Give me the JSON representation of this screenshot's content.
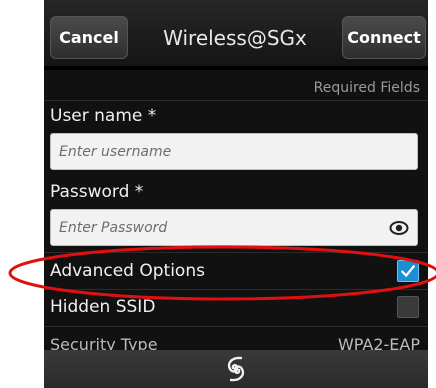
{
  "titlebar": {
    "cancel_label": "Cancel",
    "title": "Wireless@SGx",
    "connect_label": "Connect"
  },
  "form": {
    "required_note": "Required Fields",
    "username_label": "User name *",
    "username_placeholder": "Enter username",
    "password_label": "Password *",
    "password_placeholder": "Enter Password",
    "advanced_label": "Advanced Options",
    "advanced_checked": true,
    "hidden_ssid_label": "Hidden SSID",
    "hidden_ssid_checked": false,
    "security_type_label": "Security Type",
    "security_type_value": "WPA2-EAP"
  },
  "icons": {
    "show_password": "eye-icon",
    "bottom_bar": "action-swirl-icon"
  },
  "annotation": {
    "color": "#e01010",
    "target": "advanced-options-row"
  },
  "colors": {
    "checkbox_checked": "#1a8fd4",
    "background": "#111111",
    "field_background": "#f2f2f2"
  }
}
